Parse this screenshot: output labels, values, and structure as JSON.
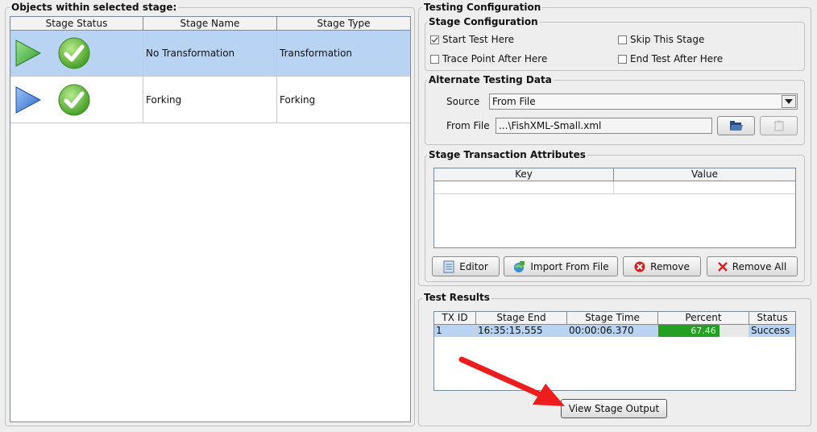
{
  "left_panel": {
    "title": "Objects within selected stage:",
    "columns": [
      "Stage Status",
      "Stage Name",
      "Stage Type"
    ],
    "rows": [
      {
        "name": "No Transformation",
        "type": "Transformation",
        "play_color": "#3cb043",
        "selected": true
      },
      {
        "name": "Forking",
        "type": "Forking",
        "play_color": "#2f6fd0",
        "selected": false
      }
    ]
  },
  "testing_config": {
    "title": "Testing Configuration",
    "stage_config": {
      "title": "Stage Configuration",
      "start_test_here": "Start Test Here",
      "start_test_checked": true,
      "skip_this_stage": "Skip This Stage",
      "trace_point": "Trace Point After Here",
      "end_test": "End Test After Here"
    },
    "alternate_data": {
      "title": "Alternate Testing Data",
      "source_label": "Source",
      "source_value": "From File",
      "from_file_label": "From File",
      "file_value": "...\\FishXML-Small.xml"
    },
    "transaction_attrs": {
      "title": "Stage Transaction Attributes",
      "columns": [
        "Key",
        "Value"
      ],
      "buttons": {
        "editor": "Editor",
        "import": "Import From File",
        "remove": "Remove",
        "remove_all": "Remove All"
      }
    }
  },
  "test_results": {
    "title": "Test Results",
    "columns": [
      "TX ID",
      "Stage End",
      "Stage Time",
      "Percent",
      "Status"
    ],
    "rows": [
      {
        "tx_id": "1",
        "stage_end": "16:35:15.555",
        "stage_time": "00:00:06.370",
        "percent": "67.46",
        "percent_value": 0.6746,
        "status": "Success"
      }
    ],
    "view_output": "View Stage Output"
  },
  "colors": {
    "selection": "#b8d4f2",
    "progress": "#22a022",
    "arrow": "#ee1c1c"
  }
}
